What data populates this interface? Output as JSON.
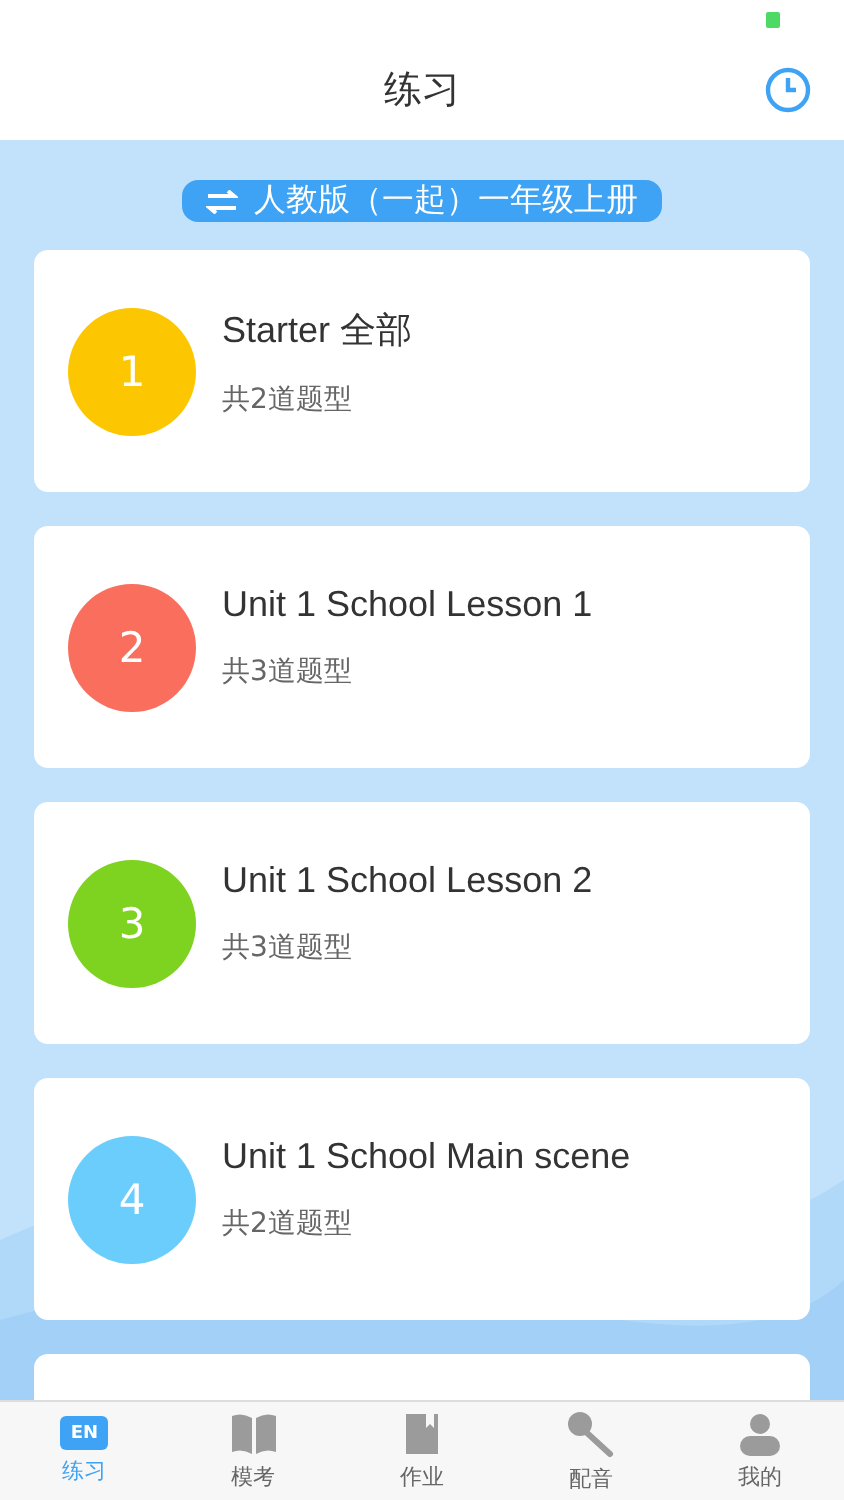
{
  "header": {
    "title": "练习"
  },
  "book_selector": {
    "label": "人教版（一起）一年级上册"
  },
  "units": [
    {
      "number": "1",
      "title": "Starter 全部",
      "subtitle": "共2道题型",
      "color": "#fcc700"
    },
    {
      "number": "2",
      "title": "Unit 1 School Lesson 1",
      "subtitle": "共3道题型",
      "color": "#f96e5d"
    },
    {
      "number": "3",
      "title": "Unit 1 School Lesson 2",
      "subtitle": "共3道题型",
      "color": "#7ed321"
    },
    {
      "number": "4",
      "title": "Unit 1 School Main scene",
      "subtitle": "共2道题型",
      "color": "#6acdfc"
    }
  ],
  "tabs": [
    {
      "label": "练习",
      "kind": "en",
      "icon_text": "EN",
      "selected": true
    },
    {
      "label": "模考",
      "kind": "book",
      "selected": false
    },
    {
      "label": "作业",
      "kind": "notebook",
      "selected": false
    },
    {
      "label": "配音",
      "kind": "mic",
      "selected": false
    },
    {
      "label": "我的",
      "kind": "person",
      "selected": false
    }
  ]
}
